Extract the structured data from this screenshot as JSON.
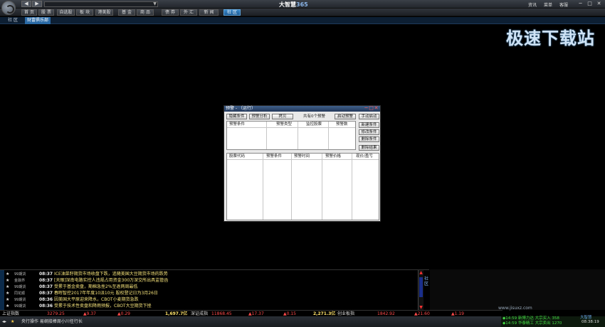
{
  "titlebar": {
    "title_brand": "大智慧",
    "title_num": "365",
    "menu": [
      "资讯",
      "菜单",
      "客服"
    ],
    "back": "◀",
    "forward": "▶",
    "search_placeholder": "",
    "drop": "▼",
    "win_min": "─",
    "win_max": "□",
    "win_close": "✕"
  },
  "nav": {
    "tabs": [
      "首 页",
      "股 票",
      "自选股",
      "板 块",
      "港美股",
      "基 金",
      "商 品",
      "债 券",
      "外 汇",
      "新 闻",
      "社 区"
    ],
    "active": "社 区"
  },
  "subnav": {
    "tabs": [
      "社 区",
      "财富俱乐部"
    ]
  },
  "dialog": {
    "title": "预警 - （运行）",
    "buttons": {
      "hide_cond": "隐藏条件",
      "analysis": "预警分析",
      "copy": "拷贝",
      "start": "启动预警",
      "manual": "手动启动",
      "new_cond": "新建条件",
      "edit_cond": "修改条件",
      "del_cond": "删除条件",
      "del_result": "删除结果"
    },
    "count_text": "共有0个预警",
    "top_cols": [
      "预警条件",
      "预警类型",
      "监控股票",
      "预警数"
    ],
    "bottom_cols": [
      "股票代码",
      "预警条件",
      "预警时间",
      "预警价格",
      "现价/盈亏"
    ]
  },
  "news": {
    "rows": [
      {
        "src": "99期货",
        "time": "08:37",
        "text": "ICE油菜籽期货市场收盘下跌，追随美国大豆期货市场的跌势"
      },
      {
        "src": "金融界",
        "time": "08:37",
        "text": "[天眼]深南电路实控人违规占用资金300万深交所出具监管函"
      },
      {
        "src": "99期货",
        "time": "08:37",
        "text": "受累于基金卖盘，期棉急挫2%至逾两周最低"
      },
      {
        "src": "同花顺",
        "time": "08:37",
        "text": "春晖智控2017年年度10派10元 股权登记日为3月26日"
      },
      {
        "src": "99期货",
        "time": "08:36",
        "text": "因美国大平原迎来降水，CBOT小麦期货急跌"
      },
      {
        "src": "99期货",
        "time": "08:36",
        "text": "受累于技术性卖盘和降雨预报，CBOT大豆期货下挫"
      }
    ],
    "side_label": "社 区"
  },
  "indexbar": {
    "name": "上证指数",
    "items": [
      "3279.25",
      "▲9.37",
      "▲0.29",
      "1,697.7亿",
      "深证成指",
      "11868.45",
      "▲17.37",
      "▲0.15",
      "2,271.3亿",
      "创业板指",
      "1842.92",
      "▲21.60",
      "▲1.19"
    ]
  },
  "bottom": {
    "left": "央行操作 易纲接棒周小川任行长"
  },
  "ticker": {
    "lines": [
      "◆14:59 新博力达 大宗买入 358",
      "◆14:59 华泰精工 大宗卖出 1270"
    ],
    "time": "08:38:19",
    "logo": "大智慧"
  },
  "watermark": {
    "text": "极速下载站",
    "url": "www.jisuxz.com"
  },
  "colors": {
    "accent": "#2a6aa6",
    "news_text": "#f5e27a",
    "up": "#ff4a4a",
    "down": "#44dd44"
  }
}
